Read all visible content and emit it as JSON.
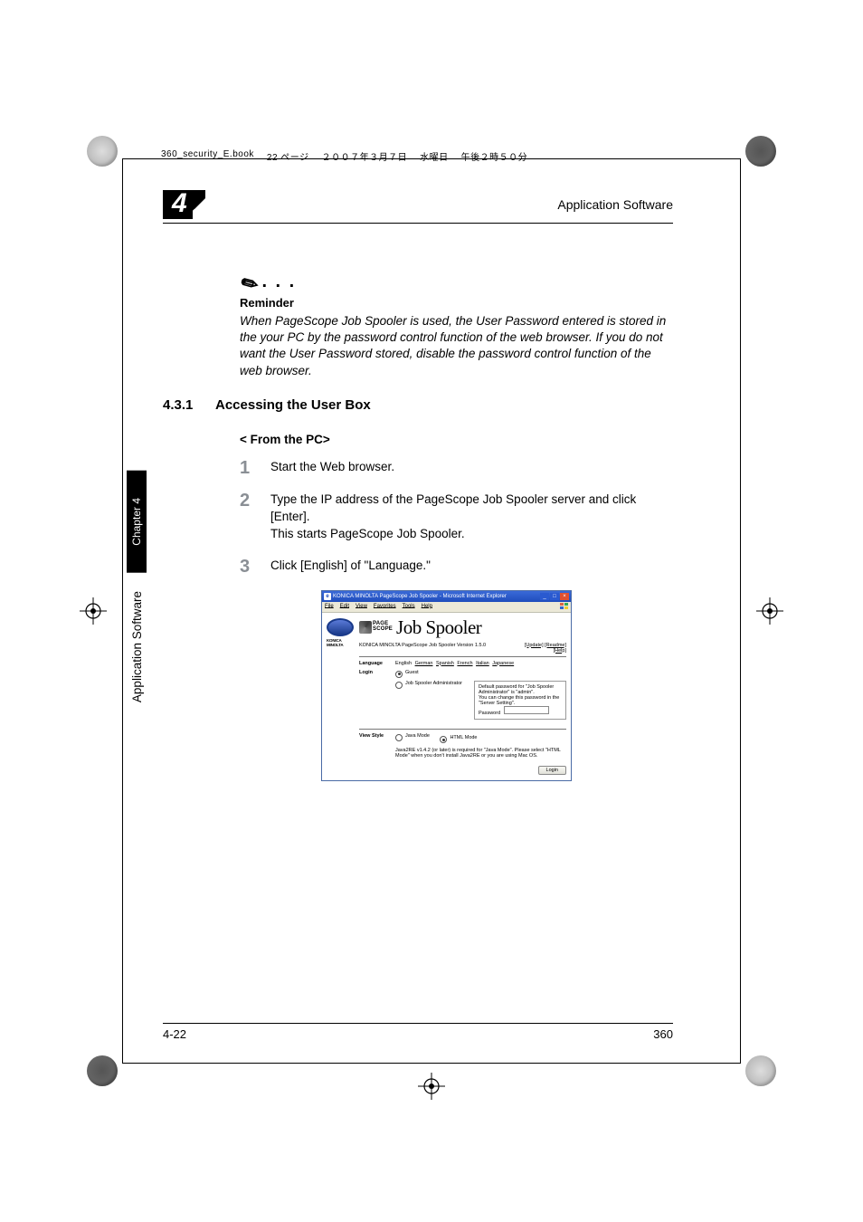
{
  "book_info": {
    "filename": "360_security_E.book",
    "page_jp": "22 ページ",
    "date_jp": "２００７年３月７日",
    "weekday_jp": "水曜日",
    "time_jp": "午後２時５０分"
  },
  "header": {
    "chapter_number": "4",
    "title": "Application Software"
  },
  "reminder": {
    "heading": "Reminder",
    "body": "When PageScope Job Spooler is used, the User Password entered is stored in the your PC by the password control function of the web browser. If you do not want the User Password stored, disable the password control function of the web browser."
  },
  "section": {
    "number": "4.3.1",
    "title": "Accessing the User Box"
  },
  "sub_heading": "< From the PC>",
  "steps": {
    "s1_num": "1",
    "s1_text": "Start the Web browser.",
    "s2_num": "2",
    "s2_line1": "Type the IP address of the PageScope Job Spooler server and click [Enter].",
    "s2_line2": "This starts PageScope Job Spooler.",
    "s3_num": "3",
    "s3_text": "Click [English] of \"Language.\""
  },
  "screenshot": {
    "window_title": "KONICA MINOLTA PageScope Job Spooler - Microsoft Internet Explorer",
    "menu": {
      "file": "File",
      "edit": "Edit",
      "view": "View",
      "favorites": "Favorites",
      "tools": "Tools",
      "help": "Help"
    },
    "brand": "KONICA MINOLTA",
    "pagescope_line1": "PAGE",
    "pagescope_line2": "SCOPE",
    "product": "Job Spooler",
    "version_text": "KONICA MINOLTA PageScope Job Spooler Version 1.5.0",
    "link_update": "[Update]",
    "link_readme": "[Readme]",
    "link_help": "[Help]",
    "label_language": "Language",
    "lang_english": "English",
    "lang_german": "German",
    "lang_spanish": "Spanish",
    "lang_french": "French",
    "lang_italian": "Italian",
    "lang_japanese": "Japanese",
    "label_login": "Login",
    "opt_guest": "Guest",
    "opt_admin": "Job Spooler Administrator",
    "admin_note1": "Default password for \"Job Spooler Administrator\" is \"admin\".",
    "admin_note2": "You can change this password in the \"Server Setting\".",
    "label_password": "Password",
    "label_viewstyle": "View Style",
    "opt_java": "Java Mode",
    "opt_html": "HTML Mode",
    "viewstyle_note": "Java2RE v1.4.2 (or later) is required for \"Java Mode\". Please select \"HTML Mode\" when you don't install Java2RE or you are using Mac OS.",
    "btn_login": "Login"
  },
  "sidebar": {
    "chapter_label": "Chapter 4",
    "section_label": "Application Software"
  },
  "footer": {
    "page": "4-22",
    "model": "360"
  }
}
